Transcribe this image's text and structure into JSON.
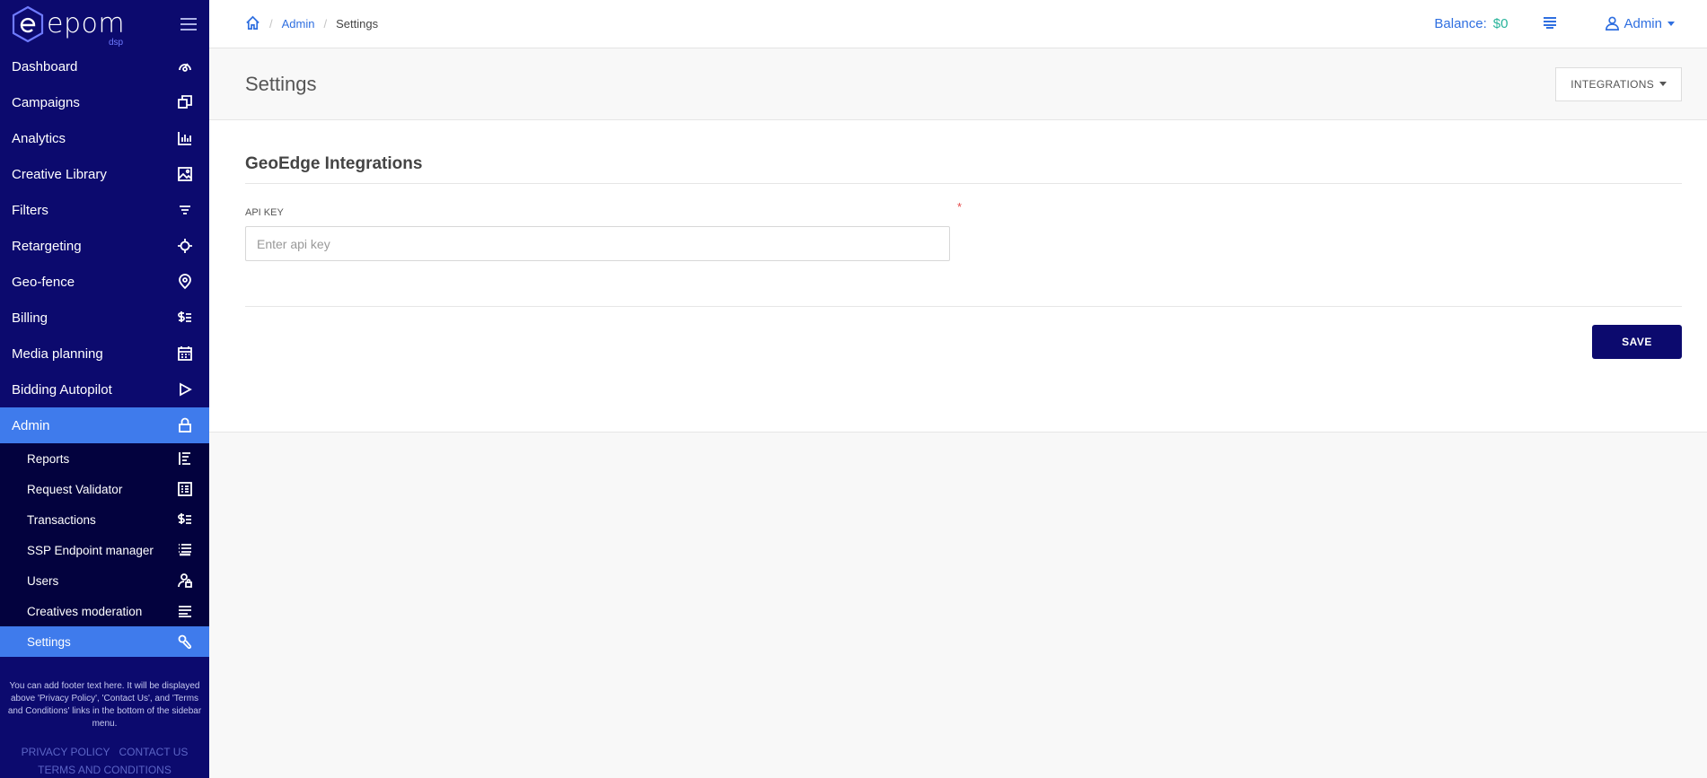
{
  "brand": {
    "name": "epom",
    "sub": "dsp"
  },
  "nav": [
    {
      "label": "Dashboard",
      "icon": "dashboard-icon"
    },
    {
      "label": "Campaigns",
      "icon": "campaigns-icon"
    },
    {
      "label": "Analytics",
      "icon": "analytics-icon"
    },
    {
      "label": "Creative Library",
      "icon": "image-icon"
    },
    {
      "label": "Filters",
      "icon": "filter-icon"
    },
    {
      "label": "Retargeting",
      "icon": "crosshair-icon"
    },
    {
      "label": "Geo-fence",
      "icon": "location-pin-icon"
    },
    {
      "label": "Billing",
      "icon": "billing-icon"
    },
    {
      "label": "Media planning",
      "icon": "calendar-icon"
    },
    {
      "label": "Bidding Autopilot",
      "icon": "play-icon"
    },
    {
      "label": "Admin",
      "icon": "lock-icon",
      "active": true
    }
  ],
  "admin_sub": [
    {
      "label": "Reports",
      "icon": "reports-icon"
    },
    {
      "label": "Request Validator",
      "icon": "table-icon"
    },
    {
      "label": "Transactions",
      "icon": "billing-icon"
    },
    {
      "label": "SSP Endpoint manager",
      "icon": "ssp-list-icon"
    },
    {
      "label": "Users",
      "icon": "user-lock-icon"
    },
    {
      "label": "Creatives moderation",
      "icon": "moderation-icon"
    },
    {
      "label": "Settings",
      "icon": "wrench-icon",
      "active": true
    }
  ],
  "footer": {
    "text": "You can add footer text here. It will be displayed above 'Privacy Policy', 'Contact Us', and 'Terms and Conditions' links in the bottom of the sidebar menu.",
    "privacy": "PRIVACY POLICY",
    "contact": "CONTACT US",
    "terms": "TERMS AND CONDITIONS"
  },
  "breadcrumb": {
    "admin": "Admin",
    "current": "Settings"
  },
  "topbar": {
    "balance_label": "Balance:",
    "balance_value": "$0",
    "user": "Admin"
  },
  "page": {
    "title": "Settings",
    "integrations_button": "INTEGRATIONS"
  },
  "form": {
    "section_title": "GeoEdge Integrations",
    "api_key_label": "API KEY",
    "required_mark": "*",
    "api_key_placeholder": "Enter api key",
    "api_key_value": "",
    "save_label": "SAVE"
  },
  "colors": {
    "sidebar": "#0c0a6e",
    "sidebar_sub": "#03023e",
    "active": "#3f7bec",
    "link": "#2f6fe0",
    "balance": "#27b39a",
    "required": "#e54a4a"
  }
}
